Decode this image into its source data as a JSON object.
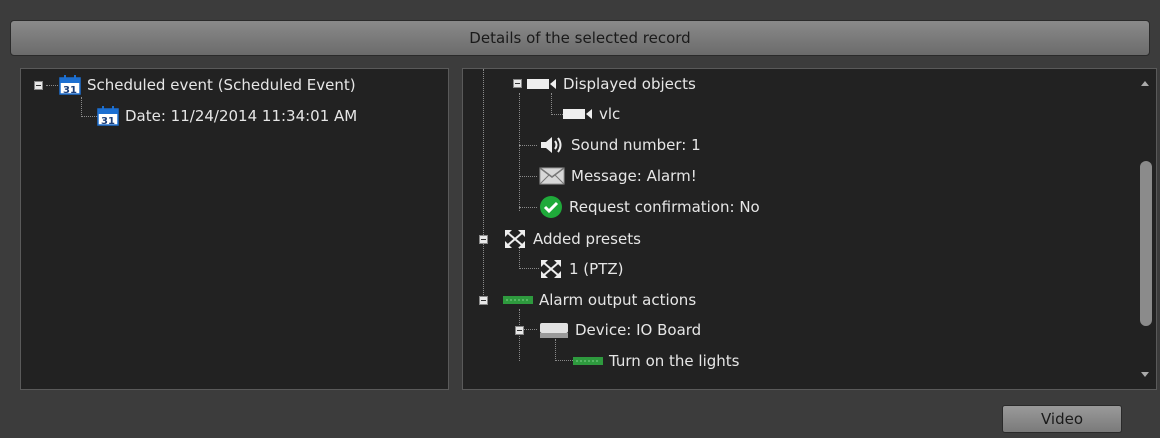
{
  "header": {
    "title": "Details of the selected record"
  },
  "left_tree": {
    "root": {
      "label": "Scheduled event (Scheduled Event)",
      "icon": "calendar-icon"
    },
    "child": {
      "label": "Date: 11/24/2014 11:34:01 AM",
      "icon": "calendar-icon"
    }
  },
  "right_tree": {
    "displayed_objects": {
      "label": "Displayed objects",
      "icon": "camera-icon"
    },
    "vlc": {
      "label": "vlc",
      "icon": "camera-icon"
    },
    "sound": {
      "label": "Sound number: 1",
      "icon": "speaker-icon"
    },
    "message": {
      "label": "Message: Alarm!",
      "icon": "envelope-icon"
    },
    "confirmation": {
      "label": "Request confirmation: No",
      "icon": "checkmark-icon"
    },
    "added_presets": {
      "label": "Added presets",
      "icon": "ptz-icon"
    },
    "preset_1": {
      "label": "1 (PTZ)",
      "icon": "ptz-icon"
    },
    "alarm_output": {
      "label": "Alarm output actions",
      "icon": "io-output-icon"
    },
    "device": {
      "label": "Device: IO Board",
      "icon": "device-icon"
    },
    "lights": {
      "label": "Turn on the lights",
      "icon": "io-output-icon"
    }
  },
  "footer": {
    "video_label": "Video"
  },
  "colors": {
    "calendar_blue": "#1c6fd1",
    "check_green": "#1faa3a",
    "io_green": "#2e9a3e"
  }
}
